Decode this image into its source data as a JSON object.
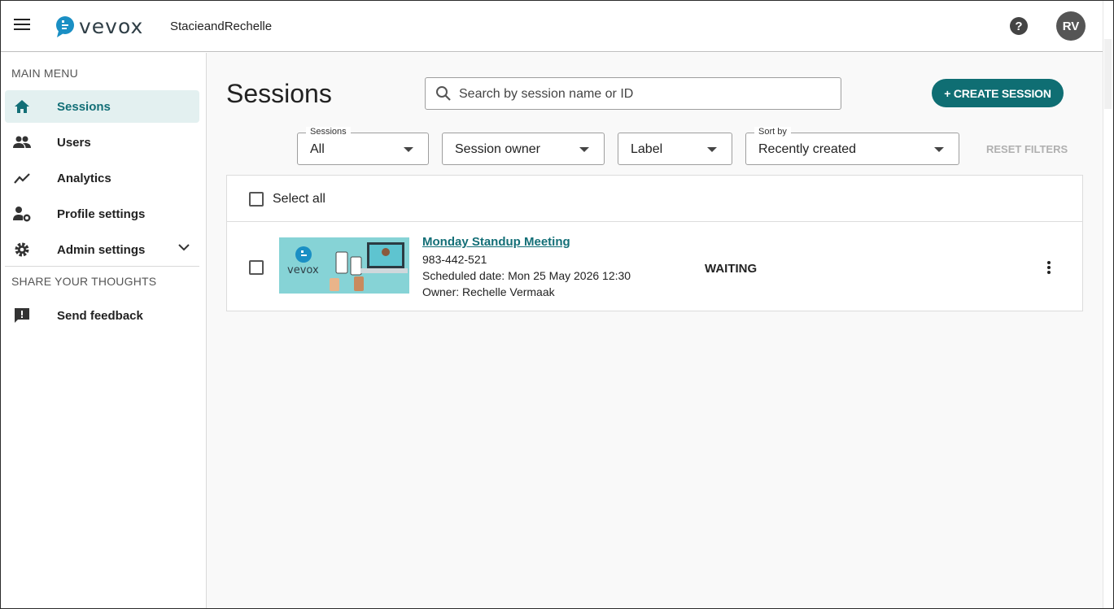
{
  "header": {
    "logo_text": "vevox",
    "org_name": "StacieandRechelle",
    "help_label": "?",
    "avatar_initials": "RV"
  },
  "sidebar": {
    "main_menu_title": "MAIN MENU",
    "items": [
      {
        "label": "Sessions",
        "icon": "home-icon",
        "active": true
      },
      {
        "label": "Users",
        "icon": "users-icon"
      },
      {
        "label": "Analytics",
        "icon": "analytics-icon"
      },
      {
        "label": "Profile settings",
        "icon": "profile-settings-icon"
      },
      {
        "label": "Admin settings",
        "icon": "gear-icon"
      }
    ],
    "share_title": "SHARE YOUR THOUGHTS",
    "feedback_label": "Send feedback"
  },
  "main": {
    "title": "Sessions",
    "search_placeholder": "Search by session name or ID",
    "create_label": "+ CREATE SESSION",
    "filters": {
      "sessions": {
        "label": "Sessions",
        "value": "All"
      },
      "owner": {
        "value": "Session owner"
      },
      "label": {
        "value": "Label"
      },
      "sort": {
        "label": "Sort by",
        "value": "Recently created"
      }
    },
    "reset_label": "RESET FILTERS",
    "select_all_label": "Select all",
    "sessions": [
      {
        "title": "Monday Standup Meeting",
        "id": "983-442-521",
        "scheduled": "Scheduled date: Mon 25 May 2026 12:30",
        "owner": "Owner: Rechelle Vermaak",
        "status": "WAITING",
        "thumb_text": "vevox"
      }
    ]
  },
  "colors": {
    "accent": "#0f6e73",
    "active_bg": "#e3f0f0"
  }
}
